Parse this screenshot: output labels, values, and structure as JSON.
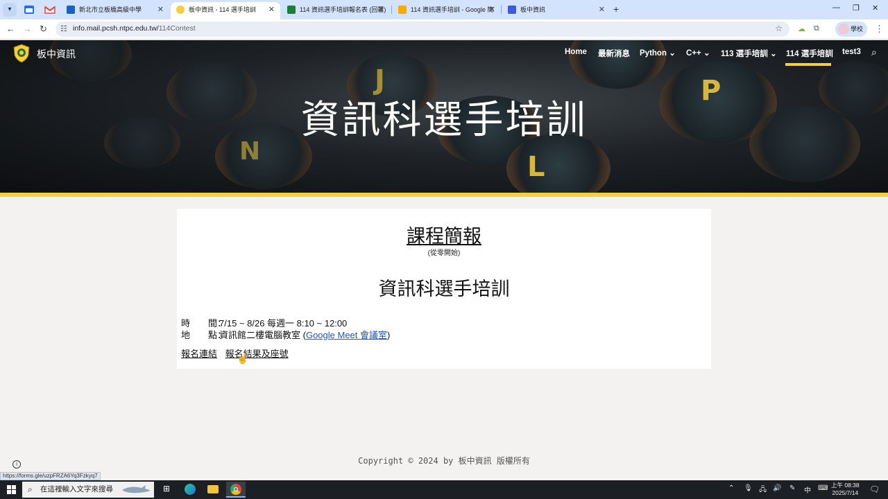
{
  "browser": {
    "tabs": [
      {
        "title": "新北市立板橋高級中學",
        "favicon_color": "#1565c0"
      },
      {
        "title": "板中資訊 - 114 選手培訓",
        "favicon_color": "#f4d03f",
        "active": true
      },
      {
        "title": "114 資訊選手培訓報名表 (回覆)",
        "favicon_color": "#188038"
      },
      {
        "title": "114 資訊選手培訓 - Google 簡",
        "favicon_color": "#f9ab00"
      },
      {
        "title": "板中資訊",
        "favicon_color": "#3b5bdb"
      }
    ],
    "close_glyph": "✕",
    "new_tab_glyph": "+",
    "url_host": "info.mail.pcsh.ntpc.edu.tw/",
    "url_path": "114Contest",
    "profile_label": "學校"
  },
  "site": {
    "name": "板中資訊",
    "nav": [
      {
        "label": "Home"
      },
      {
        "label": "最新消息"
      },
      {
        "label": "Python",
        "has_dropdown": true
      },
      {
        "label": "C++",
        "has_dropdown": true
      },
      {
        "label": "113 選手培訓",
        "has_dropdown": true
      },
      {
        "label": "114 選手培訓",
        "active": true
      },
      {
        "label": "test3"
      }
    ],
    "accent_color": "#f4d03f"
  },
  "hero": {
    "title": "資訊科選手培訓"
  },
  "content": {
    "title": "課程簡報",
    "subtitle": "(從零開始)",
    "heading": "資訊科選手培訓",
    "time_label": "時　　間：",
    "time_value": "7/15 ~ 8/26 每週一 8:10 ~ 12:00",
    "place_label": "地　　點：",
    "place_value": "資訊館二樓電腦教室 (",
    "meet_link": "Google Meet 會議室",
    "place_close": ")",
    "links": [
      "報名連結",
      "報名結果及座號"
    ]
  },
  "footer": {
    "copyright": "Copyright © 2024 by 板中資訊 版權所有"
  },
  "status_bar": {
    "hover_url": "https://forms.gle/uzpFRZA6Yq3Fzkyq7"
  },
  "taskbar": {
    "search_placeholder": "在這裡輸入文字來搜尋",
    "ime": "中",
    "time": "上午 08:38",
    "date": "2025/7/14"
  }
}
